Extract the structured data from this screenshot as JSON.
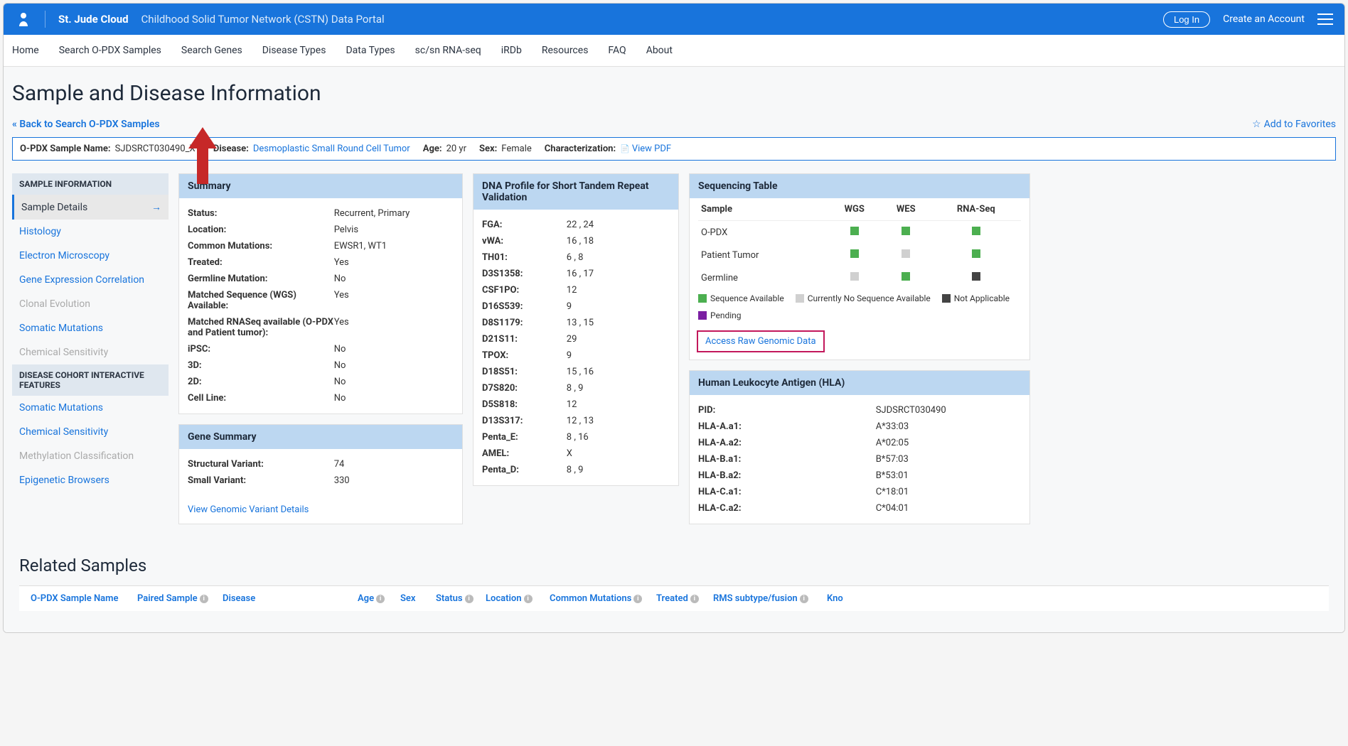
{
  "header": {
    "brand": "St. Jude Cloud",
    "portal": "Childhood Solid Tumor Network (CSTN) Data Portal",
    "login": "Log In",
    "create_account": "Create an Account"
  },
  "nav": [
    "Home",
    "Search O-PDX Samples",
    "Search Genes",
    "Disease Types",
    "Data Types",
    "sc/sn RNA-seq",
    "iRDb",
    "Resources",
    "FAQ",
    "About"
  ],
  "page": {
    "title": "Sample and Disease Information",
    "back": "« Back to Search O-PDX Samples",
    "favorite": "Add to Favorites"
  },
  "info_bar": {
    "sample_name_label": "O-PDX Sample Name:",
    "sample_name": "SJDSRCT030490_X1",
    "disease_label": "Disease:",
    "disease": "Desmoplastic Small Round Cell Tumor",
    "age_label": "Age:",
    "age": "20 yr",
    "sex_label": "Sex:",
    "sex": "Female",
    "char_label": "Characterization:",
    "char_link": "View PDF"
  },
  "sidebar": {
    "section1": "SAMPLE INFORMATION",
    "items1": [
      {
        "label": "Sample Details",
        "active": true
      },
      {
        "label": "Histology"
      },
      {
        "label": "Electron Microscopy"
      },
      {
        "label": "Gene Expression Correlation"
      },
      {
        "label": "Clonal Evolution",
        "disabled": true
      },
      {
        "label": "Somatic Mutations"
      },
      {
        "label": "Chemical Sensitivity",
        "disabled": true
      }
    ],
    "section2": "DISEASE COHORT INTERACTIVE FEATURES",
    "items2": [
      {
        "label": "Somatic Mutations"
      },
      {
        "label": "Chemical Sensitivity"
      },
      {
        "label": "Methylation Classification",
        "disabled": true
      },
      {
        "label": "Epigenetic Browsers"
      }
    ]
  },
  "summary": {
    "title": "Summary",
    "rows": [
      {
        "k": "Status:",
        "v": "Recurrent, Primary"
      },
      {
        "k": "Location:",
        "v": "Pelvis"
      },
      {
        "k": "Common Mutations:",
        "v": "EWSR1, WT1"
      },
      {
        "k": "Treated:",
        "v": "Yes"
      },
      {
        "k": "Germline Mutation:",
        "v": "No"
      },
      {
        "k": "Matched Sequence (WGS) Available:",
        "v": "Yes"
      },
      {
        "k": "Matched RNASeq available (O-PDX and Patient tumor):",
        "v": "Yes"
      },
      {
        "k": "iPSC:",
        "v": "No"
      },
      {
        "k": "3D:",
        "v": "No"
      },
      {
        "k": "2D:",
        "v": "No"
      },
      {
        "k": "Cell Line:",
        "v": "No"
      }
    ]
  },
  "gene_summary": {
    "title": "Gene Summary",
    "rows": [
      {
        "k": "Structural Variant:",
        "v": "74"
      },
      {
        "k": "Small Variant:",
        "v": "330"
      }
    ],
    "link": "View Genomic Variant Details"
  },
  "dna_profile": {
    "title": "DNA Profile for Short Tandem Repeat Validation",
    "rows": [
      {
        "k": "FGA:",
        "v": "22 , 24"
      },
      {
        "k": "vWA:",
        "v": "16 , 18"
      },
      {
        "k": "TH01:",
        "v": "6 , 8"
      },
      {
        "k": "D3S1358:",
        "v": "16 , 17"
      },
      {
        "k": "CSF1PO:",
        "v": "12"
      },
      {
        "k": "D16S539:",
        "v": "9"
      },
      {
        "k": "D8S1179:",
        "v": "13 , 15"
      },
      {
        "k": "D21S11:",
        "v": "29"
      },
      {
        "k": "TPOX:",
        "v": "9"
      },
      {
        "k": "D18S51:",
        "v": "15 , 16"
      },
      {
        "k": "D7S820:",
        "v": "8 , 9"
      },
      {
        "k": "D5S818:",
        "v": "12"
      },
      {
        "k": "D13S317:",
        "v": "12 , 13"
      },
      {
        "k": "Penta_E:",
        "v": "8 , 16"
      },
      {
        "k": "AMEL:",
        "v": "X"
      },
      {
        "k": "Penta_D:",
        "v": "8 , 9"
      }
    ]
  },
  "sequencing": {
    "title": "Sequencing Table",
    "headers": [
      "Sample",
      "WGS",
      "WES",
      "RNA-Seq"
    ],
    "rows": [
      {
        "label": "O-PDX",
        "cells": [
          "green",
          "green",
          "green"
        ]
      },
      {
        "label": "Patient Tumor",
        "cells": [
          "green",
          "grey",
          "green"
        ]
      },
      {
        "label": "Germline",
        "cells": [
          "grey",
          "green",
          "dark"
        ]
      }
    ],
    "legend": [
      {
        "color": "green",
        "text": "Sequence Available"
      },
      {
        "color": "grey",
        "text": "Currently No Sequence Available"
      },
      {
        "color": "dark",
        "text": "Not Applicable"
      },
      {
        "color": "purple",
        "text": "Pending"
      }
    ],
    "access_link": "Access Raw Genomic Data"
  },
  "hla": {
    "title": "Human Leukocyte Antigen (HLA)",
    "rows": [
      {
        "k": "PID:",
        "v": "SJDSRCT030490"
      },
      {
        "k": "HLA-A.a1:",
        "v": "A*33:03"
      },
      {
        "k": "HLA-A.a2:",
        "v": "A*02:05"
      },
      {
        "k": "HLA-B.a1:",
        "v": "B*57:03"
      },
      {
        "k": "HLA-B.a2:",
        "v": "B*53:01"
      },
      {
        "k": "HLA-C.a1:",
        "v": "C*18:01"
      },
      {
        "k": "HLA-C.a2:",
        "v": "C*04:01"
      }
    ]
  },
  "related": {
    "title": "Related Samples",
    "columns": [
      "O-PDX Sample Name",
      "Paired Sample",
      "Disease",
      "Age",
      "Sex",
      "Status",
      "Location",
      "Common Mutations",
      "Treated",
      "RMS subtype/fusion",
      "Kno"
    ]
  }
}
